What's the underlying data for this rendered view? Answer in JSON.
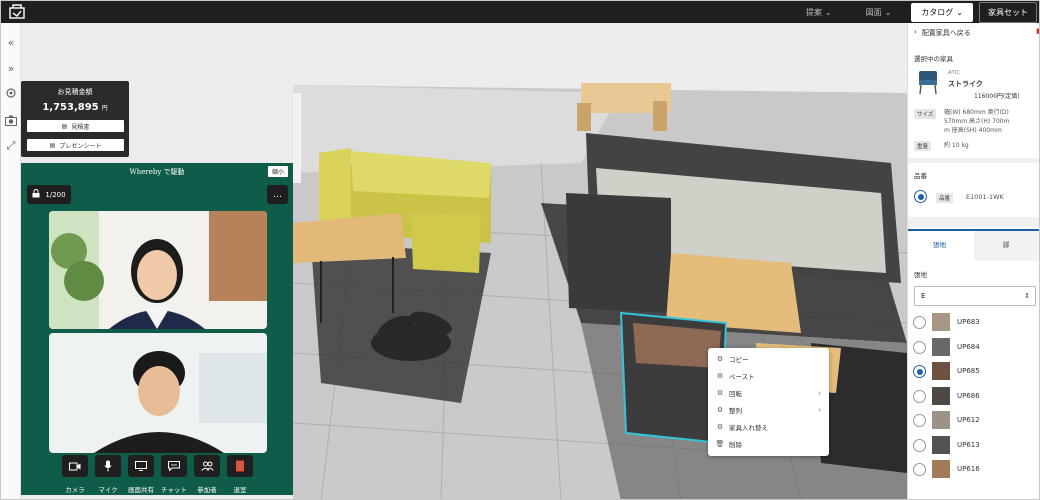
{
  "topbar": {
    "nav": [
      "提案",
      "図面"
    ],
    "catalog_tab": "カタログ",
    "furniture_set_tab": "家具セット"
  },
  "estimate": {
    "label": "お見積金額",
    "amount": "1,753,895",
    "currency": "円",
    "buttons": [
      "見積書",
      "プレゼンシート"
    ]
  },
  "whereby": {
    "header": "Whereby で駆動",
    "shrink": "縮小",
    "participants": "1/200",
    "more": "…",
    "toolbar": [
      "カメラ",
      "マイク",
      "画面共有",
      "チャット",
      "参加者",
      "退室"
    ]
  },
  "context_menu": {
    "items": [
      {
        "label": "コピー",
        "submenu": false,
        "icon": "gear-icon"
      },
      {
        "label": "ペースト",
        "submenu": false,
        "icon": "gear-icon"
      },
      {
        "label": "回転",
        "submenu": true,
        "icon": "gear-icon"
      },
      {
        "label": "整列",
        "submenu": true,
        "icon": "gear-icon"
      },
      {
        "label": "家具入れ替え",
        "submenu": false,
        "icon": "gear-icon"
      },
      {
        "label": "削除",
        "submenu": false,
        "icon": "trash-icon"
      }
    ]
  },
  "right_panel": {
    "back": "配置家具へ戻る",
    "delete_icon": "trash-icon",
    "selected_heading": "選択中の家具",
    "brand": "ATIC",
    "name": "ストライク",
    "price": "116000円(定価)",
    "size_tag": "サイズ",
    "size_text": [
      "幅(W) 680mm 奥行(D)",
      "570mm 高さ(H) 700m",
      "m 座高(SH) 400mm"
    ],
    "weight_tag": "重量",
    "weight_text": "約 10 kg",
    "part_heading": "品番",
    "part_tag": "品番",
    "part_number": "E1001-1WK",
    "tabs": [
      "張地",
      "脚"
    ],
    "fabric_heading": "張地",
    "select_value": "E",
    "swatches": [
      {
        "code": "UP683",
        "color": "#a89684",
        "selected": false
      },
      {
        "code": "UP684",
        "color": "#6a6866",
        "selected": false
      },
      {
        "code": "UP685",
        "color": "#6e5141",
        "selected": true
      },
      {
        "code": "UP686",
        "color": "#4e4a43",
        "selected": false
      },
      {
        "code": "UP612",
        "color": "#9c9288",
        "selected": false
      },
      {
        "code": "UP613",
        "color": "#55524f",
        "selected": false
      },
      {
        "code": "UP616",
        "color": "#a27c58",
        "selected": false
      }
    ]
  }
}
